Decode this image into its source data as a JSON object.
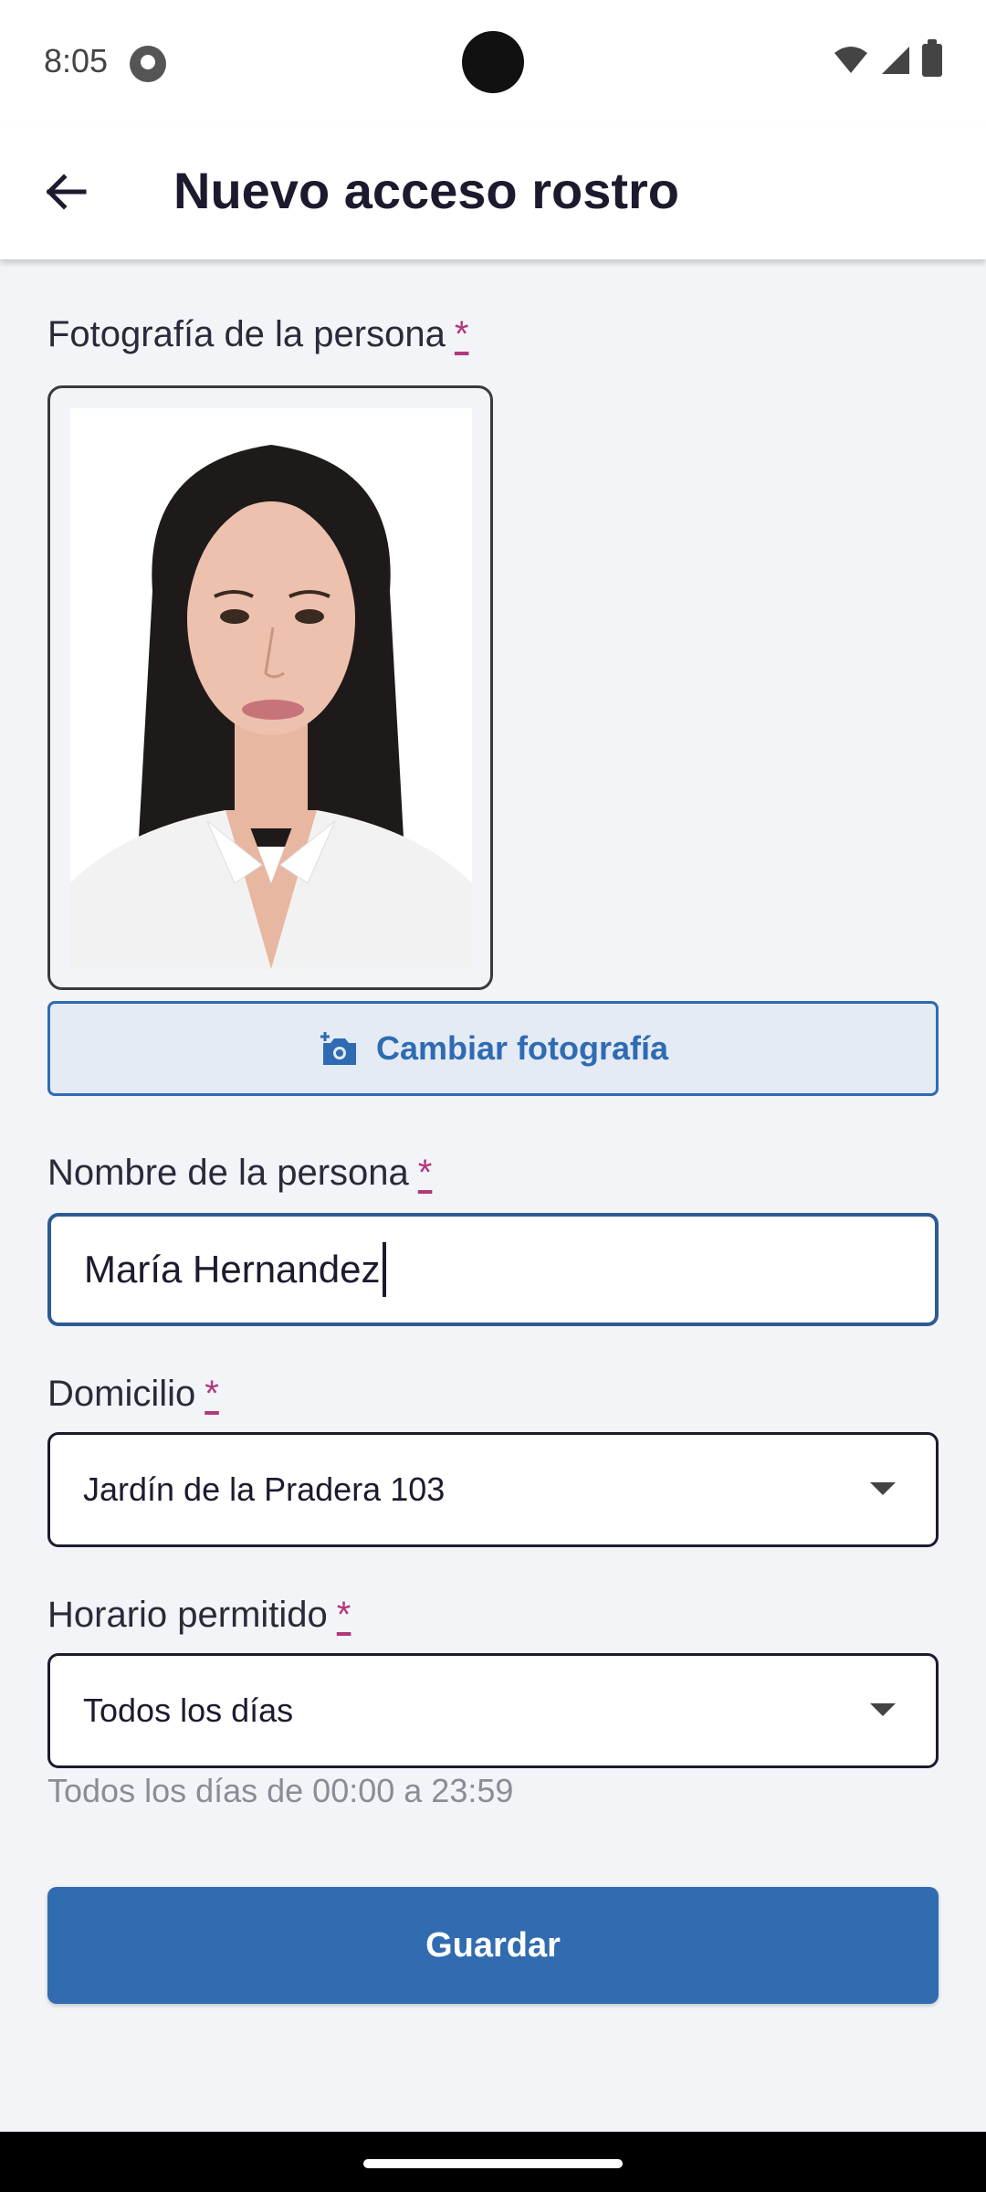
{
  "status_bar": {
    "time": "8:05"
  },
  "app_bar": {
    "title": "Nuevo acceso rostro"
  },
  "form": {
    "photo": {
      "label": "Fotografía de la persona",
      "required_marker": "*",
      "change_button_label": "Cambiar fotografía"
    },
    "name": {
      "label": "Nombre de la persona",
      "required_marker": "*",
      "value": "María Hernandez"
    },
    "address": {
      "label": "Domicilio",
      "required_marker": "*",
      "selected": "Jardín de la Pradera 103"
    },
    "schedule": {
      "label": "Horario permitido",
      "required_marker": "*",
      "selected": "Todos los días",
      "helper": "Todos los días de 00:00 a 23:59"
    },
    "save_label": "Guardar"
  },
  "icons": [
    "back-arrow-icon",
    "add-photo-icon",
    "dropdown-arrow-icon",
    "wifi-icon",
    "signal-icon",
    "battery-icon"
  ],
  "colors": {
    "primary": "#316bb0",
    "required": "#b0387c",
    "background": "#f3f4f8"
  }
}
